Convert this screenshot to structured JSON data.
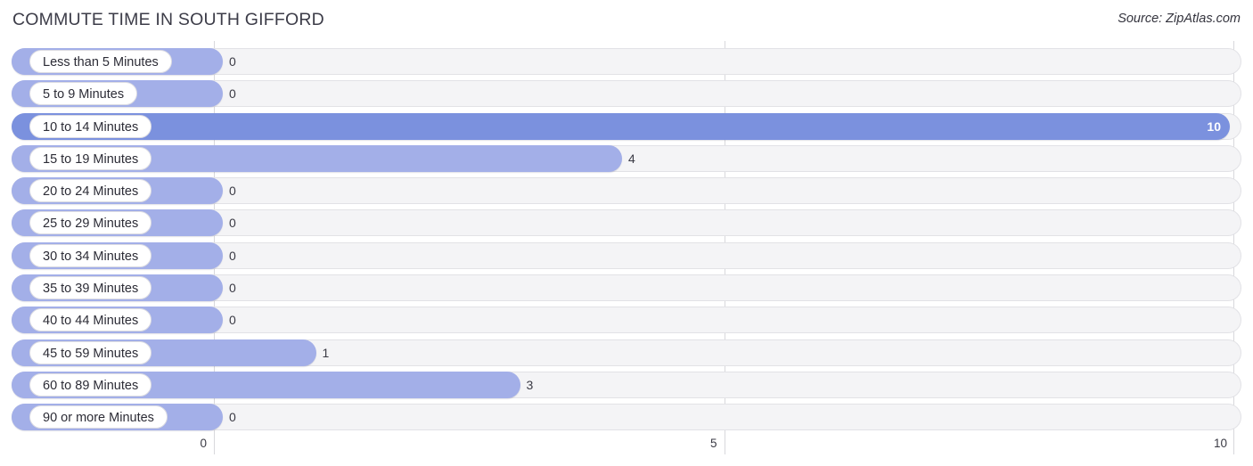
{
  "header": {
    "title": "COMMUTE TIME IN SOUTH GIFFORD",
    "source": "Source: ZipAtlas.com"
  },
  "colors": {
    "bar_light": "#a3afe8",
    "bar_dark": "#7b91de",
    "track": "#f4f4f6",
    "gridline": "#d8d8dc",
    "text": "#3a3a44"
  },
  "chart_data": {
    "type": "bar",
    "orientation": "horizontal",
    "title": "COMMUTE TIME IN SOUTH GIFFORD",
    "xlabel": "",
    "ylabel": "",
    "xlim": [
      0,
      10
    ],
    "grid": true,
    "ticks": [
      "0",
      "5",
      "10"
    ],
    "tick_values": [
      0,
      5,
      10
    ],
    "categories": [
      "Less than 5 Minutes",
      "5 to 9 Minutes",
      "10 to 14 Minutes",
      "15 to 19 Minutes",
      "20 to 24 Minutes",
      "25 to 29 Minutes",
      "30 to 34 Minutes",
      "35 to 39 Minutes",
      "40 to 44 Minutes",
      "45 to 59 Minutes",
      "60 to 89 Minutes",
      "90 or more Minutes"
    ],
    "values": [
      0,
      0,
      10,
      4,
      0,
      0,
      0,
      0,
      0,
      1,
      3,
      0
    ],
    "value_labels": [
      "0",
      "0",
      "10",
      "4",
      "0",
      "0",
      "0",
      "0",
      "0",
      "1",
      "3",
      "0"
    ]
  }
}
